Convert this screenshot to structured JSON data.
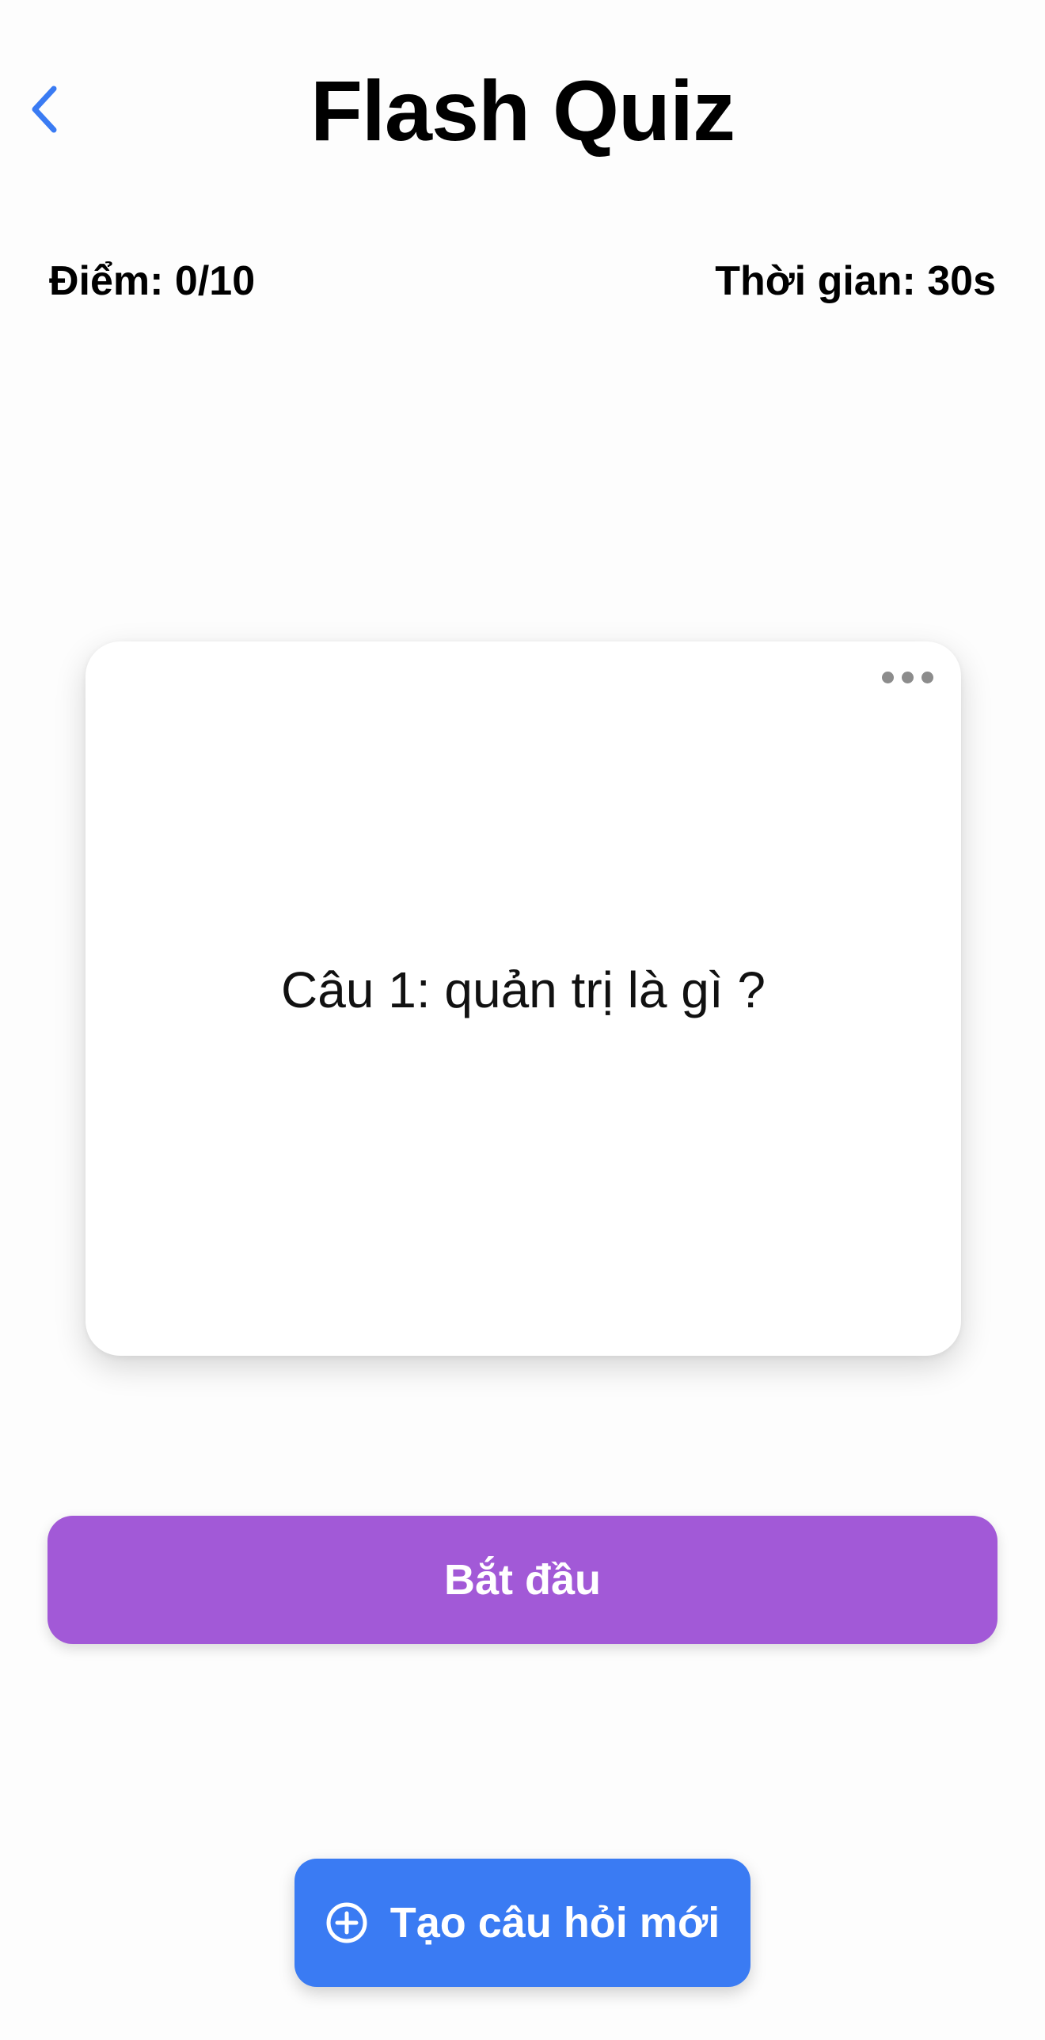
{
  "header": {
    "title": "Flash Quiz",
    "back_icon": "chevron-left-icon"
  },
  "status": {
    "score": "Điểm: 0/10",
    "timer": "Thời gian: 30s"
  },
  "card": {
    "question": "Câu 1: quản trị là gì ?",
    "menu_icon": "ellipsis-icon"
  },
  "actions": {
    "start_label": "Bắt đầu",
    "new_question_label": "Tạo câu hỏi mới",
    "new_question_icon": "plus-circle-icon"
  },
  "colors": {
    "accent_blue": "#3a7bf3",
    "start_purple": "#a259d7",
    "back_icon": "#3a7bf3"
  }
}
